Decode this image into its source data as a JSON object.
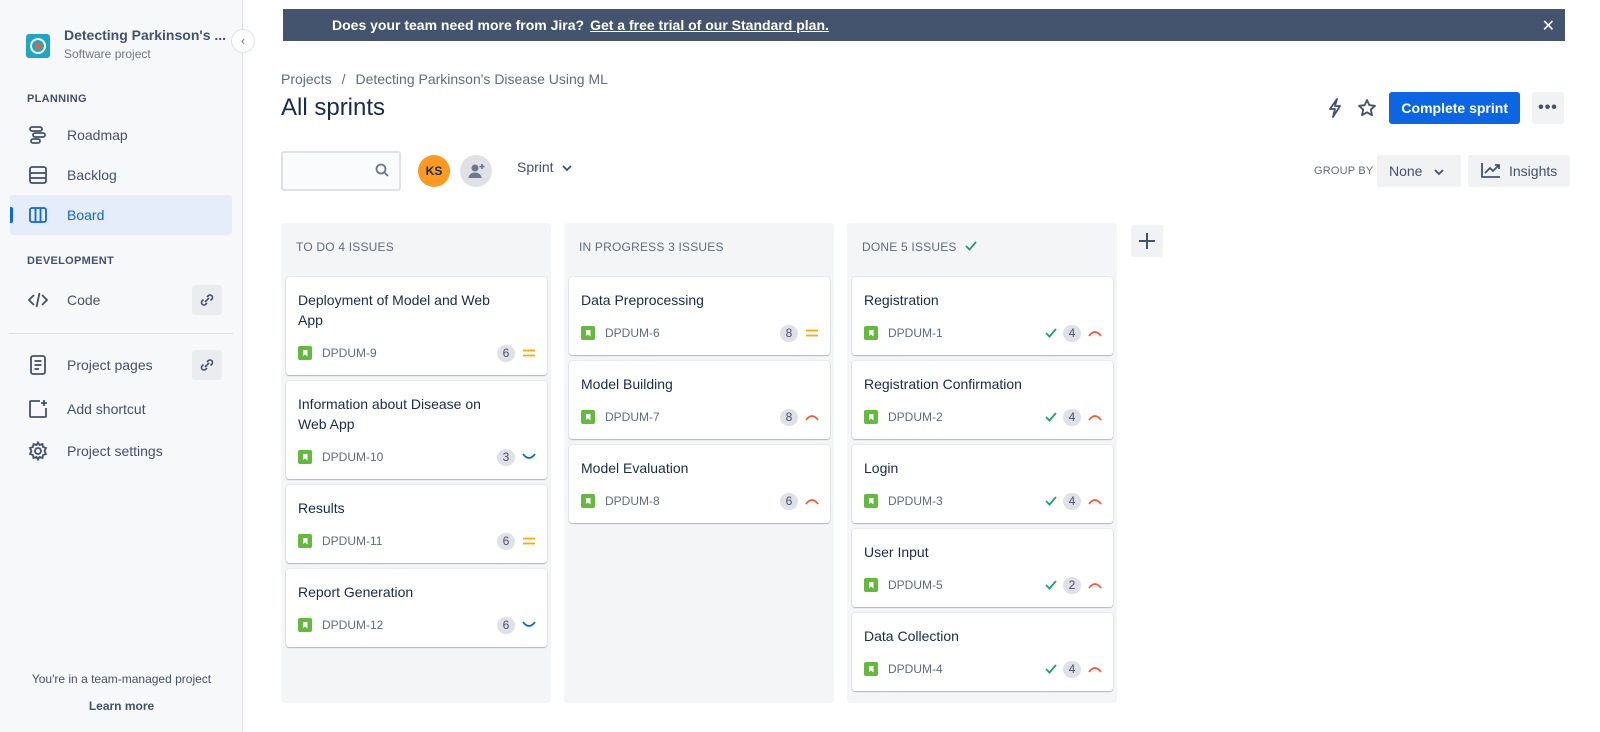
{
  "sidebar": {
    "project_name": "Detecting Parkinson's ...",
    "project_type": "Software project",
    "collapse_icon": "chevron-left-icon",
    "planning_title": "PLANNING",
    "planning": [
      {
        "label": "Roadmap",
        "icon": "roadmap-icon"
      },
      {
        "label": "Backlog",
        "icon": "backlog-icon"
      },
      {
        "label": "Board",
        "icon": "board-icon",
        "active": true
      }
    ],
    "development_title": "DEVELOPMENT",
    "code_label": "Code",
    "project_pages_label": "Project pages",
    "add_shortcut_label": "Add shortcut",
    "project_settings_label": "Project settings",
    "team_note": "You're in a team-managed project",
    "learn_more": "Learn more"
  },
  "banner": {
    "question": "Does your team need more from Jira?",
    "link": "Get a free trial of our Standard plan.",
    "close": "✕"
  },
  "header": {
    "breadcrumb_root": "Projects",
    "breadcrumb_sep": "/",
    "breadcrumb_project": "Detecting Parkinson's Disease Using ML",
    "title": "All sprints",
    "complete_sprint": "Complete sprint",
    "more": "•••"
  },
  "toolbar": {
    "search_placeholder": "",
    "avatar_initials": "KS",
    "sprint_label": "Sprint",
    "group_by_label": "GROUP BY",
    "group_by_value": "None",
    "insights_label": "Insights"
  },
  "colors": {
    "accent": "#0c66e4",
    "banner": "#44546f",
    "story": "#63ba3c",
    "high": "#ff5630",
    "medium": "#ffab00",
    "low": "#0065ff",
    "done": "#22a06b"
  },
  "board": {
    "columns": [
      {
        "title": "TO DO 4 ISSUES",
        "done": false,
        "cards": [
          {
            "title": "Deployment of Model and Web App",
            "key": "DPDUM-9",
            "points": "6",
            "priority": "medium"
          },
          {
            "title": "Information about Disease on Web App",
            "key": "DPDUM-10",
            "points": "3",
            "priority": "low"
          },
          {
            "title": "Results",
            "key": "DPDUM-11",
            "points": "6",
            "priority": "medium"
          },
          {
            "title": "Report Generation",
            "key": "DPDUM-12",
            "points": "6",
            "priority": "low"
          }
        ]
      },
      {
        "title": "IN PROGRESS 3 ISSUES",
        "done": false,
        "cards": [
          {
            "title": "Data Preprocessing",
            "key": "DPDUM-6",
            "points": "8",
            "priority": "medium"
          },
          {
            "title": "Model Building",
            "key": "DPDUM-7",
            "points": "8",
            "priority": "high"
          },
          {
            "title": "Model Evaluation",
            "key": "DPDUM-8",
            "points": "6",
            "priority": "high"
          }
        ]
      },
      {
        "title": "DONE 5 ISSUES",
        "done": true,
        "cards": [
          {
            "title": "Registration",
            "key": "DPDUM-1",
            "points": "4",
            "priority": "high"
          },
          {
            "title": "Registration Confirmation",
            "key": "DPDUM-2",
            "points": "4",
            "priority": "high"
          },
          {
            "title": "Login",
            "key": "DPDUM-3",
            "points": "4",
            "priority": "high"
          },
          {
            "title": "User Input",
            "key": "DPDUM-5",
            "points": "2",
            "priority": "high"
          },
          {
            "title": "Data Collection",
            "key": "DPDUM-4",
            "points": "4",
            "priority": "high"
          }
        ]
      }
    ]
  }
}
